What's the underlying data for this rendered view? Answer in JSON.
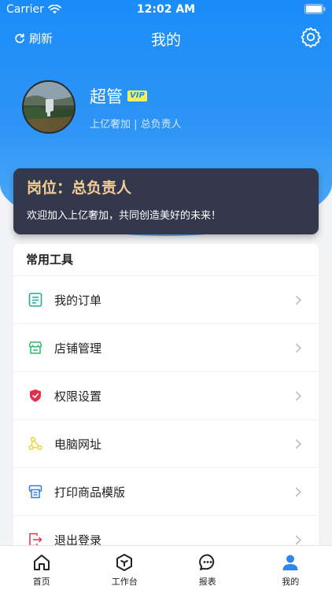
{
  "status_bar": {
    "carrier": "Carrier",
    "time": "12:02 AM"
  },
  "nav": {
    "refresh_label": "刷新",
    "title": "我的"
  },
  "profile": {
    "name": "超管",
    "badge": "VIP",
    "subtitle": "上亿奢加 | 总负责人"
  },
  "role_card": {
    "title": "岗位：总负责人",
    "message": "欢迎加入上亿奢加，共同创造美好的未来！"
  },
  "tools": {
    "header": "常用工具",
    "items": [
      {
        "label": "我的订单",
        "icon": "order-list-icon",
        "color": "#25a89a"
      },
      {
        "label": "店铺管理",
        "icon": "store-icon",
        "color": "#2eb86b"
      },
      {
        "label": "权限设置",
        "icon": "shield-icon",
        "color": "#e0304a"
      },
      {
        "label": "电脑网址",
        "icon": "network-icon",
        "color": "#e8d53a"
      },
      {
        "label": "打印商品模版",
        "icon": "printer-icon",
        "color": "#2f7de8"
      },
      {
        "label": "退出登录",
        "icon": "logout-icon",
        "color": "#e0304a"
      }
    ]
  },
  "tab_bar": {
    "tabs": [
      {
        "label": "首页",
        "icon": "home-icon"
      },
      {
        "label": "工作台",
        "icon": "workbench-icon"
      },
      {
        "label": "报表",
        "icon": "report-chat-icon"
      },
      {
        "label": "我的",
        "icon": "profile-icon",
        "active": true
      }
    ]
  },
  "colors": {
    "accent": "#1a8cf8",
    "card_bg": "#34384c",
    "role_title": "#f2ce93"
  }
}
